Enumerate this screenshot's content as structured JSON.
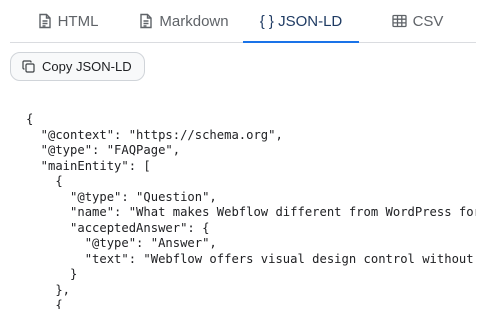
{
  "tabs": [
    {
      "label": "HTML",
      "icon": "file-text-icon",
      "active": false
    },
    {
      "label": "Markdown",
      "icon": "file-text-icon",
      "active": false
    },
    {
      "label": "{ } JSON-LD",
      "icon": "",
      "active": true
    },
    {
      "label": "CSV",
      "icon": "table-icon",
      "active": false
    }
  ],
  "copy_button": {
    "label": "Copy JSON-LD",
    "icon": "copy-icon"
  },
  "code_lines": [
    "{",
    "  \"@context\": \"https://schema.org\",",
    "  \"@type\": \"FAQPage\",",
    "  \"mainEntity\": [",
    "    {",
    "      \"@type\": \"Question\",",
    "      \"name\": \"What makes Webflow different from WordPress for",
    "      \"acceptedAnswer\": {",
    "        \"@type\": \"Answer\",",
    "        \"text\": \"Webflow offers visual design control without c",
    "      }",
    "    },",
    "    {"
  ],
  "colors": {
    "active_tab_underline": "#1a73e8",
    "active_tab_text": "#1f3b63",
    "inactive_tab_text": "#5f6368",
    "tab_divider": "#dadce0"
  }
}
